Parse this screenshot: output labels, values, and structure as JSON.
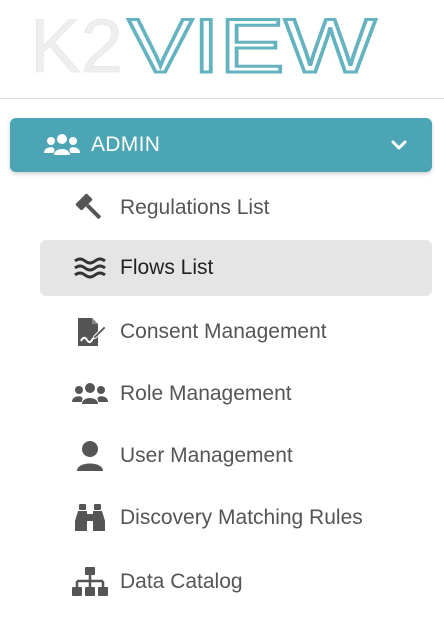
{
  "logo": {
    "text_left": "K2",
    "text_right": "VIEW",
    "color_left": "#eeeeee",
    "color_right": "#65b2c0"
  },
  "section": {
    "label": "ADMIN",
    "icon": "users-icon",
    "expanded": true,
    "color": "#4ba5b4"
  },
  "menu": {
    "items": [
      {
        "label": "Regulations List",
        "icon": "gavel-icon",
        "active": false
      },
      {
        "label": "Flows List",
        "icon": "water-icon",
        "active": true
      },
      {
        "label": "Consent Management",
        "icon": "file-signature-icon",
        "active": false
      },
      {
        "label": "Role Management",
        "icon": "users-icon",
        "active": false
      },
      {
        "label": "User Management",
        "icon": "user-icon",
        "active": false
      },
      {
        "label": "Discovery Matching Rules",
        "icon": "binoculars-icon",
        "active": false
      },
      {
        "label": "Data Catalog",
        "icon": "sitemap-icon",
        "active": false
      }
    ]
  }
}
